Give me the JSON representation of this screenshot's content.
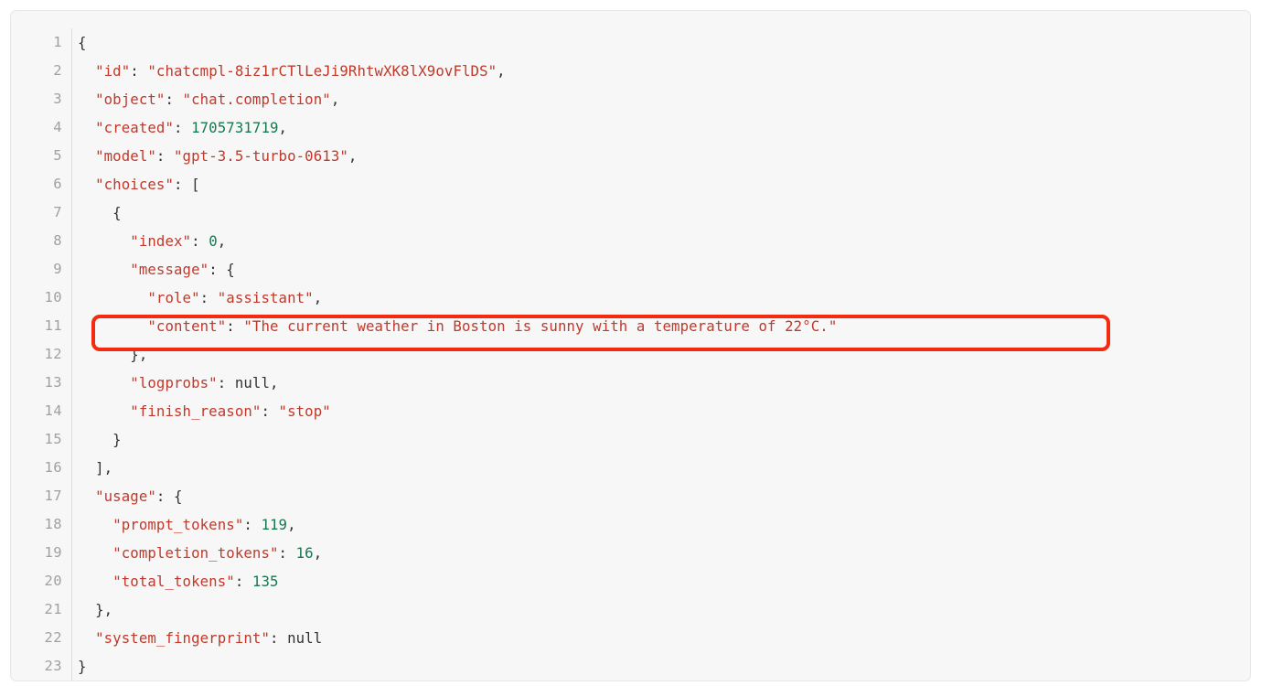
{
  "viewer": {
    "language": "json",
    "total_lines": 23,
    "colors": {
      "background": "#f7f7f7",
      "border": "#e6e6e6",
      "line_number": "#a0a0a0",
      "gutter_rule": "#dcdcdc",
      "string": "#c0392b",
      "key": "#c0392b",
      "number": "#16794f",
      "literal": "#333333",
      "punctuation": "#333333",
      "highlight": "#f42b10"
    }
  },
  "annotation": {
    "type": "highlight-rectangle",
    "color": "#f42b10",
    "target_line": 11,
    "label": "content-field-highlight"
  },
  "response": {
    "id": "chatcmpl-8iz1rCTlLeJi9RhtwXK8lX9ovFlDS",
    "object": "chat.completion",
    "created": "1705731719",
    "model": "gpt-3.5-turbo-0613",
    "choice_index": "0",
    "message_role": "assistant",
    "message_content": "The current weather in Boston is sunny with a temperature of 22°C.",
    "logprobs": "null",
    "finish_reason": "stop",
    "prompt_tokens": "119",
    "completion_tokens": "16",
    "total_tokens": "135",
    "system_fingerprint": "null"
  },
  "lines": [
    {
      "n": "1",
      "segments": [
        {
          "t": "{",
          "c": "punct"
        }
      ]
    },
    {
      "n": "2",
      "segments": [
        {
          "t": "  ",
          "c": "punct"
        },
        {
          "t": "\"id\"",
          "c": "key"
        },
        {
          "t": ": ",
          "c": "punct"
        },
        {
          "t": "\"chatcmpl-8iz1rCTlLeJi9RhtwXK8lX9ovFlDS\"",
          "c": "str"
        },
        {
          "t": ",",
          "c": "punct"
        }
      ]
    },
    {
      "n": "3",
      "segments": [
        {
          "t": "  ",
          "c": "punct"
        },
        {
          "t": "\"object\"",
          "c": "key"
        },
        {
          "t": ": ",
          "c": "punct"
        },
        {
          "t": "\"chat.completion\"",
          "c": "str"
        },
        {
          "t": ",",
          "c": "punct"
        }
      ]
    },
    {
      "n": "4",
      "segments": [
        {
          "t": "  ",
          "c": "punct"
        },
        {
          "t": "\"created\"",
          "c": "key"
        },
        {
          "t": ": ",
          "c": "punct"
        },
        {
          "t": "1705731719",
          "c": "num"
        },
        {
          "t": ",",
          "c": "punct"
        }
      ]
    },
    {
      "n": "5",
      "segments": [
        {
          "t": "  ",
          "c": "punct"
        },
        {
          "t": "\"model\"",
          "c": "key"
        },
        {
          "t": ": ",
          "c": "punct"
        },
        {
          "t": "\"gpt-3.5-turbo-0613\"",
          "c": "str"
        },
        {
          "t": ",",
          "c": "punct"
        }
      ]
    },
    {
      "n": "6",
      "segments": [
        {
          "t": "  ",
          "c": "punct"
        },
        {
          "t": "\"choices\"",
          "c": "key"
        },
        {
          "t": ": [",
          "c": "punct"
        }
      ]
    },
    {
      "n": "7",
      "segments": [
        {
          "t": "    {",
          "c": "punct"
        }
      ]
    },
    {
      "n": "8",
      "segments": [
        {
          "t": "      ",
          "c": "punct"
        },
        {
          "t": "\"index\"",
          "c": "key"
        },
        {
          "t": ": ",
          "c": "punct"
        },
        {
          "t": "0",
          "c": "num"
        },
        {
          "t": ",",
          "c": "punct"
        }
      ]
    },
    {
      "n": "9",
      "segments": [
        {
          "t": "      ",
          "c": "punct"
        },
        {
          "t": "\"message\"",
          "c": "key"
        },
        {
          "t": ": {",
          "c": "punct"
        }
      ]
    },
    {
      "n": "10",
      "segments": [
        {
          "t": "        ",
          "c": "punct"
        },
        {
          "t": "\"role\"",
          "c": "key"
        },
        {
          "t": ": ",
          "c": "punct"
        },
        {
          "t": "\"assistant\"",
          "c": "str"
        },
        {
          "t": ",",
          "c": "punct"
        }
      ]
    },
    {
      "n": "11",
      "segments": [
        {
          "t": "        ",
          "c": "punct"
        },
        {
          "t": "\"content\"",
          "c": "key"
        },
        {
          "t": ": ",
          "c": "punct"
        },
        {
          "t": "\"The current weather in Boston is sunny with a temperature of 22°C.\"",
          "c": "str"
        }
      ]
    },
    {
      "n": "12",
      "segments": [
        {
          "t": "      },",
          "c": "punct"
        }
      ]
    },
    {
      "n": "13",
      "segments": [
        {
          "t": "      ",
          "c": "punct"
        },
        {
          "t": "\"logprobs\"",
          "c": "key"
        },
        {
          "t": ": ",
          "c": "punct"
        },
        {
          "t": "null",
          "c": "lit"
        },
        {
          "t": ",",
          "c": "punct"
        }
      ]
    },
    {
      "n": "14",
      "segments": [
        {
          "t": "      ",
          "c": "punct"
        },
        {
          "t": "\"finish_reason\"",
          "c": "key"
        },
        {
          "t": ": ",
          "c": "punct"
        },
        {
          "t": "\"stop\"",
          "c": "str"
        }
      ]
    },
    {
      "n": "15",
      "segments": [
        {
          "t": "    }",
          "c": "punct"
        }
      ]
    },
    {
      "n": "16",
      "segments": [
        {
          "t": "  ],",
          "c": "punct"
        }
      ]
    },
    {
      "n": "17",
      "segments": [
        {
          "t": "  ",
          "c": "punct"
        },
        {
          "t": "\"usage\"",
          "c": "key"
        },
        {
          "t": ": {",
          "c": "punct"
        }
      ]
    },
    {
      "n": "18",
      "segments": [
        {
          "t": "    ",
          "c": "punct"
        },
        {
          "t": "\"prompt_tokens\"",
          "c": "key"
        },
        {
          "t": ": ",
          "c": "punct"
        },
        {
          "t": "119",
          "c": "num"
        },
        {
          "t": ",",
          "c": "punct"
        }
      ]
    },
    {
      "n": "19",
      "segments": [
        {
          "t": "    ",
          "c": "punct"
        },
        {
          "t": "\"completion_tokens\"",
          "c": "key"
        },
        {
          "t": ": ",
          "c": "punct"
        },
        {
          "t": "16",
          "c": "num"
        },
        {
          "t": ",",
          "c": "punct"
        }
      ]
    },
    {
      "n": "20",
      "segments": [
        {
          "t": "    ",
          "c": "punct"
        },
        {
          "t": "\"total_tokens\"",
          "c": "key"
        },
        {
          "t": ": ",
          "c": "punct"
        },
        {
          "t": "135",
          "c": "num"
        }
      ]
    },
    {
      "n": "21",
      "segments": [
        {
          "t": "  },",
          "c": "punct"
        }
      ]
    },
    {
      "n": "22",
      "segments": [
        {
          "t": "  ",
          "c": "punct"
        },
        {
          "t": "\"system_fingerprint\"",
          "c": "key"
        },
        {
          "t": ": ",
          "c": "punct"
        },
        {
          "t": "null",
          "c": "lit"
        }
      ]
    },
    {
      "n": "23",
      "segments": [
        {
          "t": "}",
          "c": "punct"
        }
      ]
    }
  ]
}
